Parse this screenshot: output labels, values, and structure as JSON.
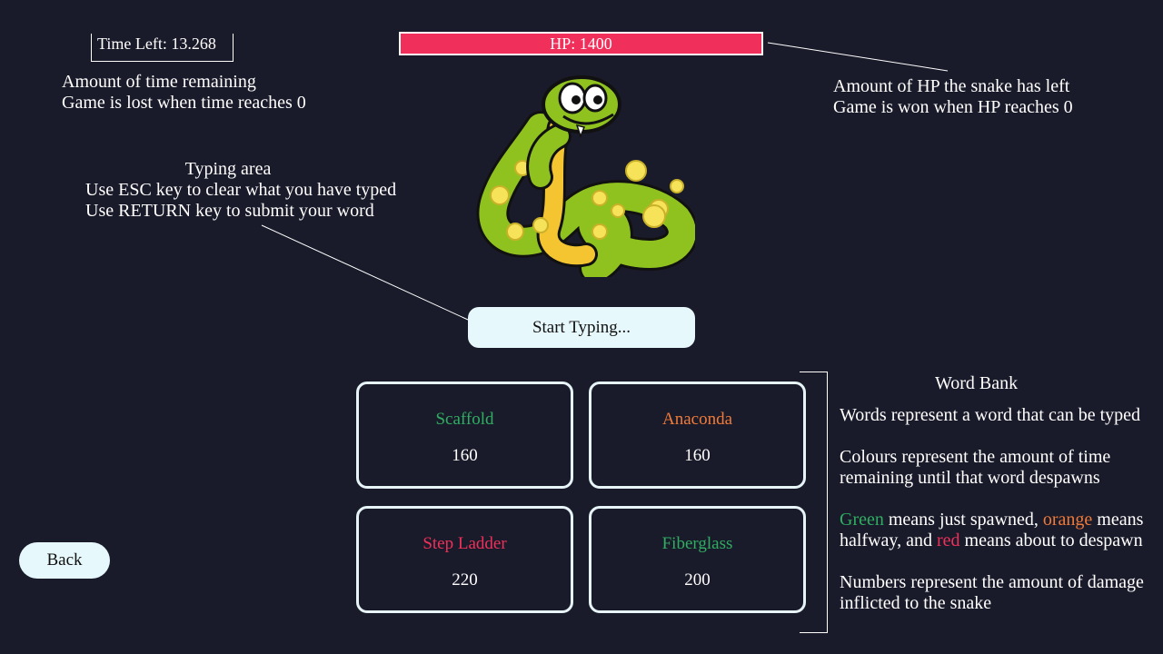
{
  "timer": {
    "label": "Time Left: 13.268"
  },
  "hp": {
    "label": "HP: 1400"
  },
  "annotations": {
    "time": [
      "Amount of time remaining",
      "Game is lost when time reaches 0"
    ],
    "hp": [
      "Amount of HP the snake has left",
      "Game is won when HP reaches 0"
    ],
    "typing": [
      "Typing area",
      "Use ESC key to clear what you have typed",
      "Use RETURN key to submit your word"
    ],
    "word_bank": {
      "title": "Word Bank",
      "p1": "Words represent a word that can be typed",
      "p2": [
        "Colours represent the amount of time",
        "remaining until that word despawns"
      ],
      "p3_line1": {
        "green": "Green",
        "mid1": " means just spawned, ",
        "orange": "orange",
        "mid2": " means"
      },
      "p3_line2": {
        "pre": "halfway, and ",
        "red": "red",
        "post": " means about to despawn"
      },
      "p4": [
        "Numbers represent the amount of damage",
        "inflicted to the snake"
      ]
    }
  },
  "input": {
    "placeholder": "Start Typing..."
  },
  "words": [
    {
      "word": "Scaffold",
      "damage": "160",
      "color": "#2fae62"
    },
    {
      "word": "Anaconda",
      "damage": "160",
      "color": "#f07a3a"
    },
    {
      "word": "Step Ladder",
      "damage": "220",
      "color": "#f0305a"
    },
    {
      "word": "Fiberglass",
      "damage": "200",
      "color": "#2fae62"
    }
  ],
  "back": {
    "label": "Back"
  },
  "colors": {
    "background": "#1a1b2a",
    "hp_bar": "#f0305a",
    "green": "#2fae62",
    "orange": "#f07a3a",
    "red": "#f0305a",
    "button_bg": "#e6f8fc"
  }
}
